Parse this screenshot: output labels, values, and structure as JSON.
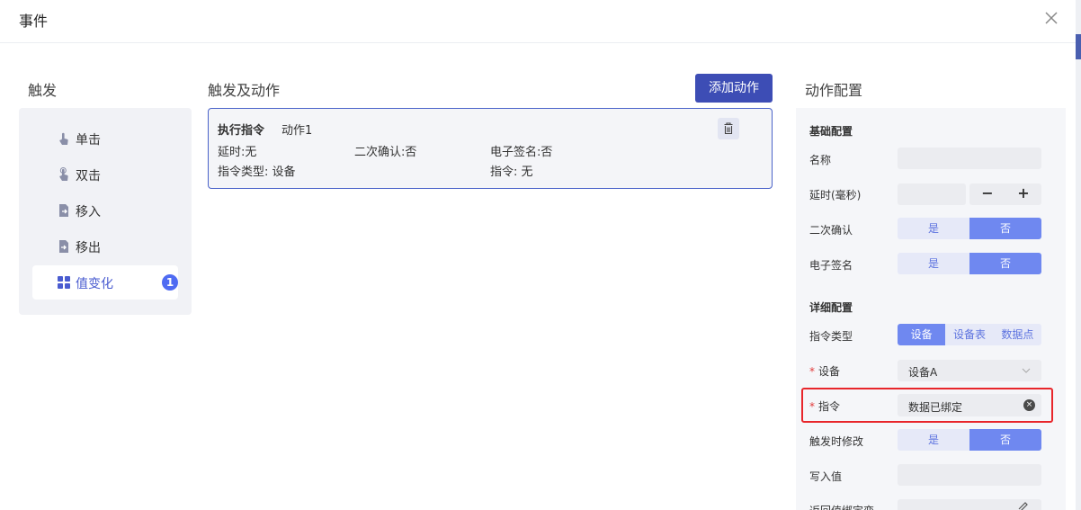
{
  "dialog": {
    "title": "事件"
  },
  "trigger": {
    "title": "触发",
    "items": [
      {
        "label": "单击",
        "icon": "tap-icon"
      },
      {
        "label": "双击",
        "icon": "double-tap-icon"
      },
      {
        "label": "移入",
        "icon": "enter-doc-icon"
      },
      {
        "label": "移出",
        "icon": "exit-doc-icon"
      },
      {
        "label": "值变化",
        "icon": "grid-icon",
        "badge": "1",
        "active": true
      }
    ]
  },
  "actions": {
    "title": "触发及动作",
    "add_button": "添加动作",
    "card": {
      "title": "执行指令",
      "name": "动作1",
      "delay": "延时:无",
      "confirm": "二次确认:否",
      "esign": "电子签名:否",
      "cmd_type": "指令类型: 设备",
      "cmd": "指令: 无"
    }
  },
  "config": {
    "title": "动作配置",
    "basic_heading": "基础配置",
    "name_label": "名称",
    "delay_label": "延时(毫秒)",
    "confirm_label": "二次确认",
    "esign_label": "电子签名",
    "detail_heading": "详细配置",
    "cmd_type_label": "指令类型",
    "cmd_type_options": [
      "设备",
      "设备表",
      "数据点"
    ],
    "device_label": "设备",
    "device_value": "设备A",
    "cmd_label": "指令",
    "cmd_value": "数据已绑定",
    "modify_label": "触发时修改",
    "write_label": "写入值",
    "return_label": "返回值绑定变",
    "yes": "是",
    "no": "否",
    "minus": "−",
    "plus": "+",
    "required_mark": "*"
  },
  "colors": {
    "primary": "#3d4db5",
    "accent": "#6f88f0",
    "highlight": "#e8262b"
  }
}
